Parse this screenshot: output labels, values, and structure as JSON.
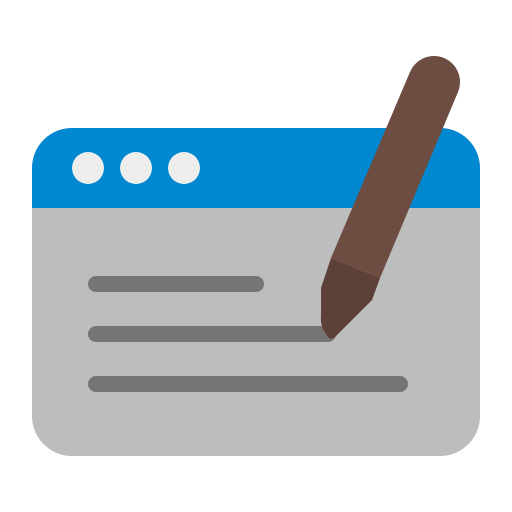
{
  "icon": {
    "name": "edit-document-window-icon",
    "window": {
      "titlebar_color": "#0288D1",
      "body_color": "#BDBDBD",
      "control_dot_color": "#EEEEEE",
      "control_dots": [
        "dot",
        "dot",
        "dot"
      ]
    },
    "text_lines": {
      "color": "#757575",
      "count": 3
    },
    "pen": {
      "body_color": "#6D4C41",
      "tip_color": "#5D4037"
    }
  }
}
